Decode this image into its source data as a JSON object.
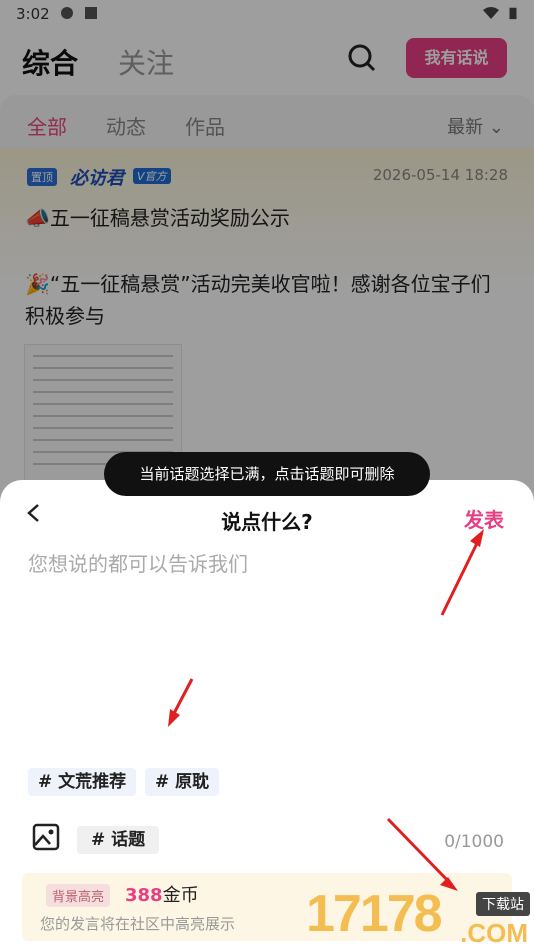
{
  "status_bar": {
    "time": "3:02"
  },
  "header": {
    "tabs": [
      {
        "label": "综合"
      },
      {
        "label": "关注"
      }
    ],
    "post_button": "我有话说"
  },
  "sub_tabs": [
    {
      "label": "全部"
    },
    {
      "label": "动态"
    },
    {
      "label": "作品"
    }
  ],
  "sort_label": "最新",
  "feed_post": {
    "badge": "置顶",
    "author": "必访君",
    "official_badge": "V官方",
    "date": "2026-05-14 18:28",
    "title": "📣五一征稿悬赏活动奖励公示",
    "body": "🎉“五一征稿悬赏”活动完美收官啦！感谢各位宝子们积极参与"
  },
  "toast": "当前话题选择已满，点击话题即可删除",
  "compose": {
    "title": "说点什么?",
    "publish": "发表",
    "placeholder": "您想说的都可以告诉我们",
    "tags": [
      "# 文荒推荐",
      "# 原耽"
    ],
    "topic_button": "# 话题",
    "counter": "0/1000"
  },
  "highlight": {
    "badge": "背景高亮",
    "price": "388",
    "unit": "金币",
    "description": "您的发言将在社区中高亮展示"
  },
  "watermark": {
    "logo": "17178",
    "label": "下载站",
    "suffix": ".COM"
  },
  "colors": {
    "accent": "#e83e83",
    "official": "#1d4fb8",
    "arrow": "#e02020"
  }
}
